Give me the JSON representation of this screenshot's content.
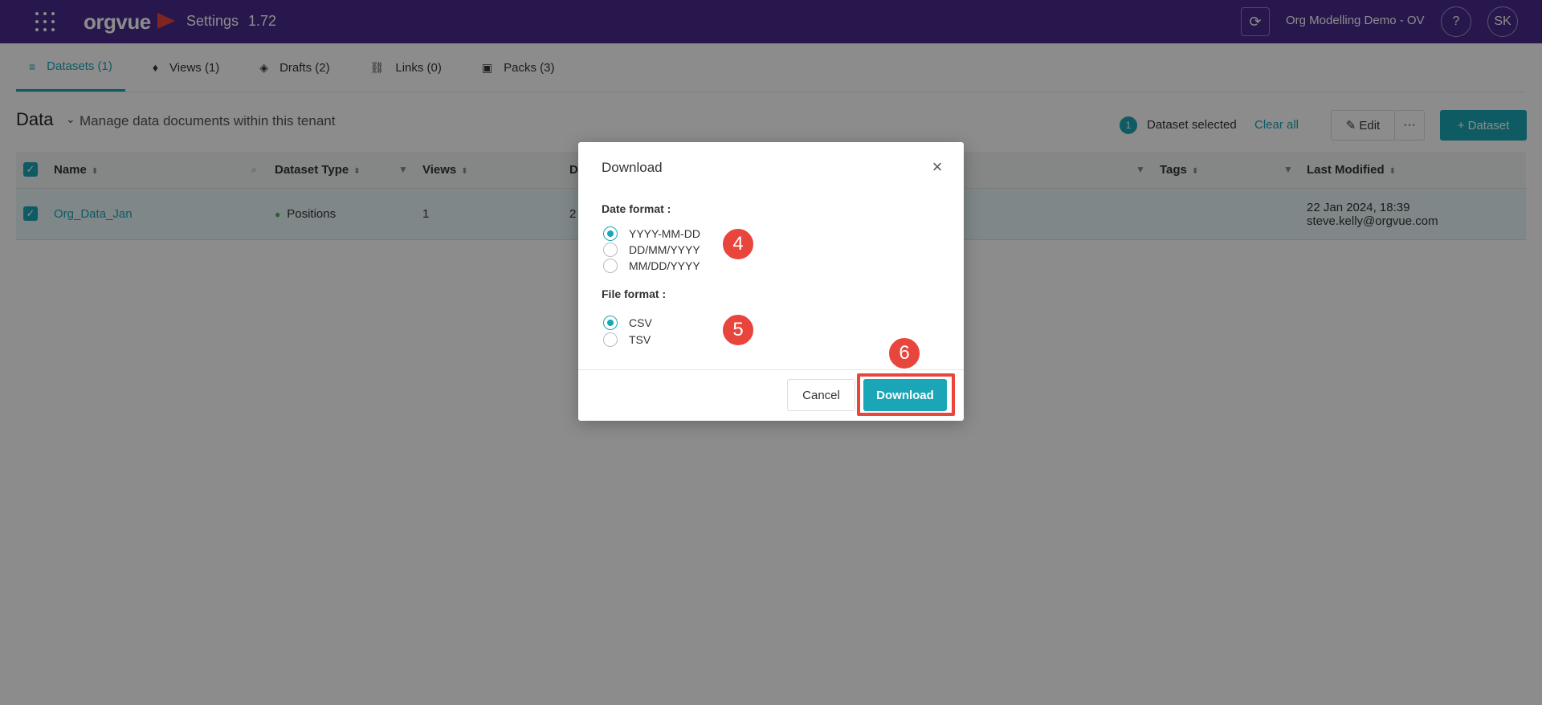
{
  "topbar": {
    "logo": "orgvue",
    "title": "Settings",
    "version": "1.72",
    "sync_icon": "refresh-icon",
    "tenant": "Org Modelling Demo - OV",
    "help": "?",
    "avatar": "SK",
    "brand_color": "#4a2a8a"
  },
  "tabs": [
    {
      "label": "Datasets (1)",
      "icon": "database-icon",
      "active": true
    },
    {
      "label": "Views (1)",
      "icon": "pin-icon"
    },
    {
      "label": "Drafts (2)",
      "icon": "layers-icon"
    },
    {
      "label": "Links (0)",
      "icon": "link-icon"
    },
    {
      "label": "Packs (3)",
      "icon": "pack-icon"
    }
  ],
  "page": {
    "title": "Data",
    "subtitle": "Manage data documents within this tenant",
    "selected_count": "1",
    "selected_text": "Dataset selected",
    "clear_all": "Clear all",
    "edit_label": "Edit",
    "more_label": "···",
    "add_label": "+ Dataset"
  },
  "table": {
    "headers": {
      "name": "Name",
      "type": "Dataset Type",
      "views": "Views",
      "d": "D",
      "tags": "Tags",
      "modified": "Last Modified"
    },
    "row": {
      "name": "Org_Data_Jan",
      "type": "Positions",
      "views": "1",
      "d": "2",
      "modified_date": "22 Jan 2024, 18:39",
      "modified_by": "steve.kelly@orgvue.com"
    }
  },
  "dialog": {
    "title": "Download",
    "close": "×",
    "date_label": "Date format :",
    "date_options": [
      {
        "label": "YYYY-MM-DD",
        "checked": true
      },
      {
        "label": "DD/MM/YYYY",
        "checked": false
      },
      {
        "label": "MM/DD/YYYY",
        "checked": false
      }
    ],
    "file_label": "File format :",
    "file_options": [
      {
        "label": "CSV",
        "checked": true
      },
      {
        "label": "TSV",
        "checked": false
      }
    ],
    "cancel": "Cancel",
    "download": "Download"
  },
  "steps": [
    "4",
    "5",
    "6"
  ],
  "accent_color": "#1aa6b7",
  "marker_color": "#e8453c"
}
